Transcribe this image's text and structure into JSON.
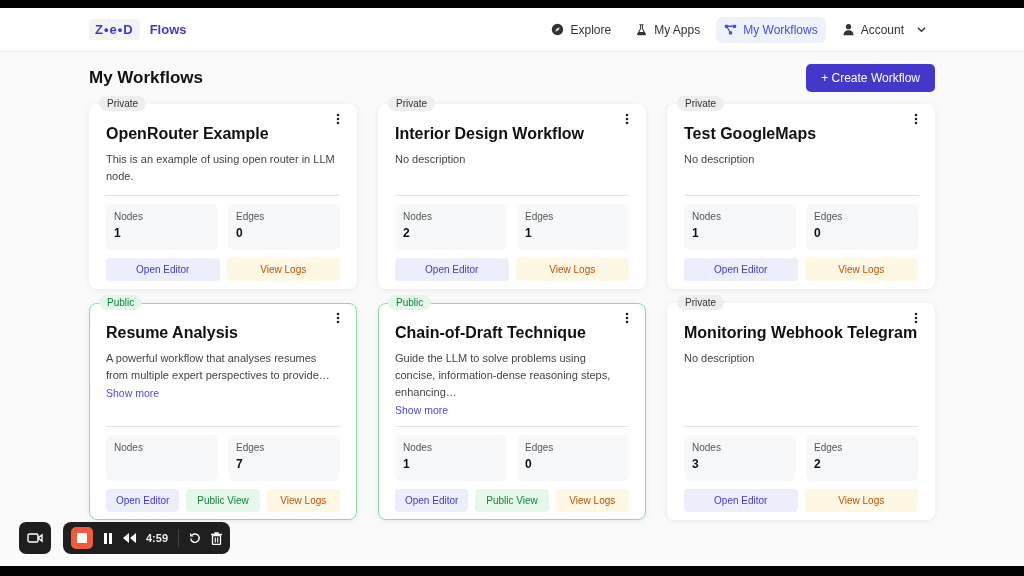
{
  "brand": {
    "logo": "Z•e•D",
    "name": "Flows"
  },
  "nav": [
    {
      "label": "Explore",
      "kind": "explore",
      "selected": false
    },
    {
      "label": "My Apps",
      "kind": "apps",
      "selected": false
    },
    {
      "label": "My Workflows",
      "kind": "workflows",
      "selected": true
    },
    {
      "label": "Account",
      "kind": "account",
      "selected": false
    }
  ],
  "page_title": "My Workflows",
  "create_button": "+ Create Workflow",
  "cards": [
    {
      "visibility": "Private",
      "public": false,
      "title": "OpenRouter Example",
      "description": "This is an example of using open router in LLM node.",
      "stats": [
        {
          "label": "Nodes",
          "value": "1"
        },
        {
          "label": "Edges",
          "value": "0"
        }
      ],
      "actions": [
        {
          "label": "Open Editor",
          "kind": "editor"
        },
        {
          "label": "View Logs",
          "kind": "logs"
        }
      ]
    },
    {
      "visibility": "Private",
      "public": false,
      "title": "Interior Design Workflow",
      "description": "No description",
      "stats": [
        {
          "label": "Nodes",
          "value": "2"
        },
        {
          "label": "Edges",
          "value": "1"
        }
      ],
      "actions": [
        {
          "label": "Open Editor",
          "kind": "editor"
        },
        {
          "label": "View Logs",
          "kind": "logs"
        }
      ]
    },
    {
      "visibility": "Private",
      "public": false,
      "title": "Test GoogleMaps",
      "description": "No description",
      "stats": [
        {
          "label": "Nodes",
          "value": "1"
        },
        {
          "label": "Edges",
          "value": "0"
        }
      ],
      "actions": [
        {
          "label": "Open Editor",
          "kind": "editor"
        },
        {
          "label": "View Logs",
          "kind": "logs"
        }
      ]
    },
    {
      "visibility": "Public",
      "public": true,
      "title": "Resume Analysis",
      "description": "A powerful workflow that analyses resumes from multiple expert perspectives to provide…",
      "show_more": "Show more",
      "stats": [
        {
          "label": "Nodes"
        },
        {
          "label": "Edges",
          "value": "7"
        }
      ],
      "actions": [
        {
          "label": "Open Editor",
          "kind": "editor"
        },
        {
          "label": "Public View",
          "kind": "public"
        },
        {
          "label": "View Logs",
          "kind": "logs"
        }
      ]
    },
    {
      "visibility": "Public",
      "public": true,
      "title": "Chain-of-Draft Technique",
      "description": "Guide the LLM to solve problems using concise, information-dense reasoning steps, enhancing…",
      "show_more": "Show more",
      "stats": [
        {
          "label": "Nodes",
          "value": "1"
        },
        {
          "label": "Edges",
          "value": "0"
        }
      ],
      "actions": [
        {
          "label": "Open Editor",
          "kind": "editor"
        },
        {
          "label": "Public View",
          "kind": "public"
        },
        {
          "label": "View Logs",
          "kind": "logs"
        }
      ]
    },
    {
      "visibility": "Private",
      "public": false,
      "title": "Monitoring Webhook Telegram",
      "description": "No description",
      "stats": [
        {
          "label": "Nodes",
          "value": "3"
        },
        {
          "label": "Edges",
          "value": "2"
        }
      ],
      "actions": [
        {
          "label": "Open Editor",
          "kind": "editor"
        },
        {
          "label": "View Logs",
          "kind": "logs"
        }
      ]
    }
  ],
  "recorder": {
    "time": "4:59"
  }
}
